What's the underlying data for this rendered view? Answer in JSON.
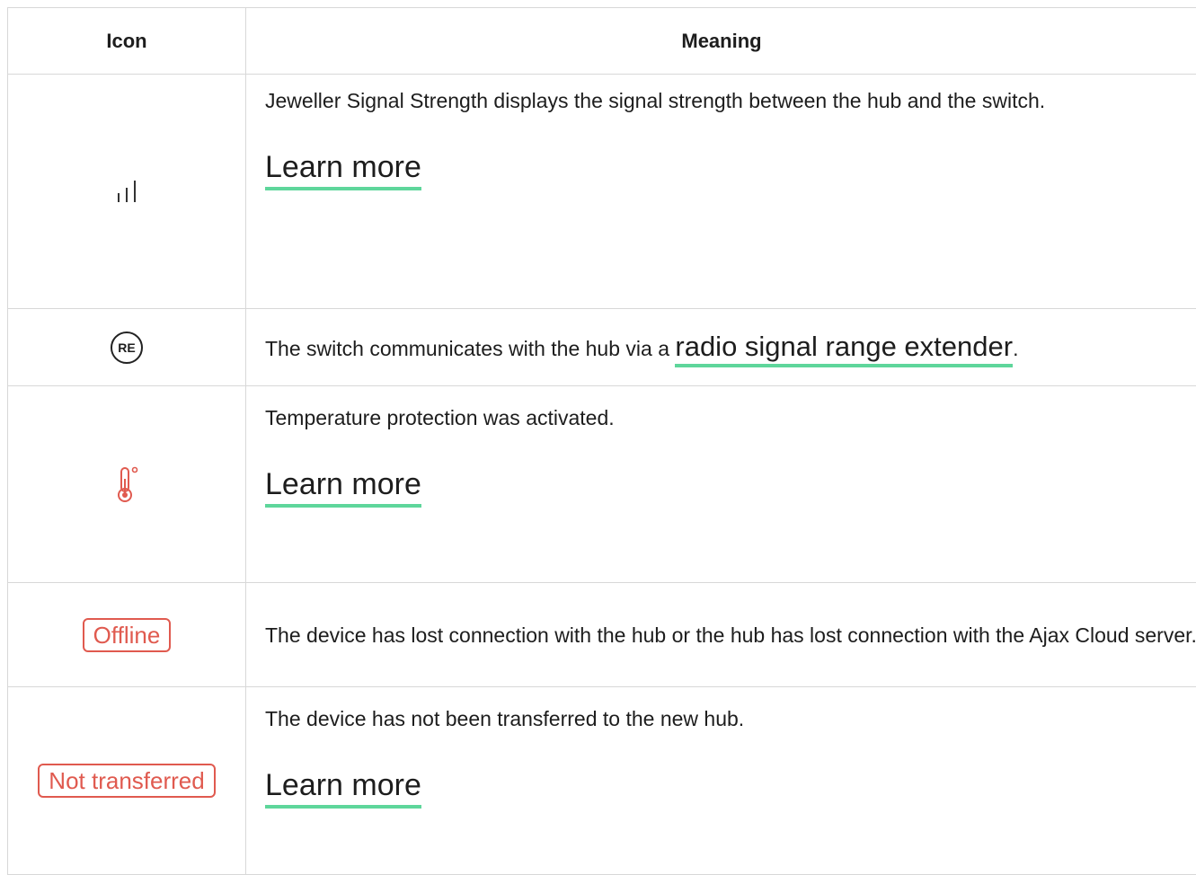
{
  "header": {
    "icon": "Icon",
    "meaning": "Meaning"
  },
  "rows": [
    {
      "icon_name": "signal-strength-icon",
      "text": "Jeweller Signal Strength displays the signal strength between the hub and the switch.",
      "link": "Learn more"
    },
    {
      "icon_name": "range-extender-icon",
      "icon_text": "RE",
      "text_before": "The switch communicates with the hub via a ",
      "link": "radio signal range extender",
      "text_after": "."
    },
    {
      "icon_name": "thermometer-icon",
      "text": "Temperature protection was activated.",
      "link": "Learn more"
    },
    {
      "badge": "Offline",
      "text": "The device has lost connection with the hub or the hub has lost connection with the Ajax Cloud server."
    },
    {
      "badge": "Not transferred",
      "text": "The device has not been transferred to the new hub.",
      "link": "Learn more"
    }
  ],
  "colors": {
    "link_underline": "#5ed69b",
    "alert": "#e05a4f"
  }
}
